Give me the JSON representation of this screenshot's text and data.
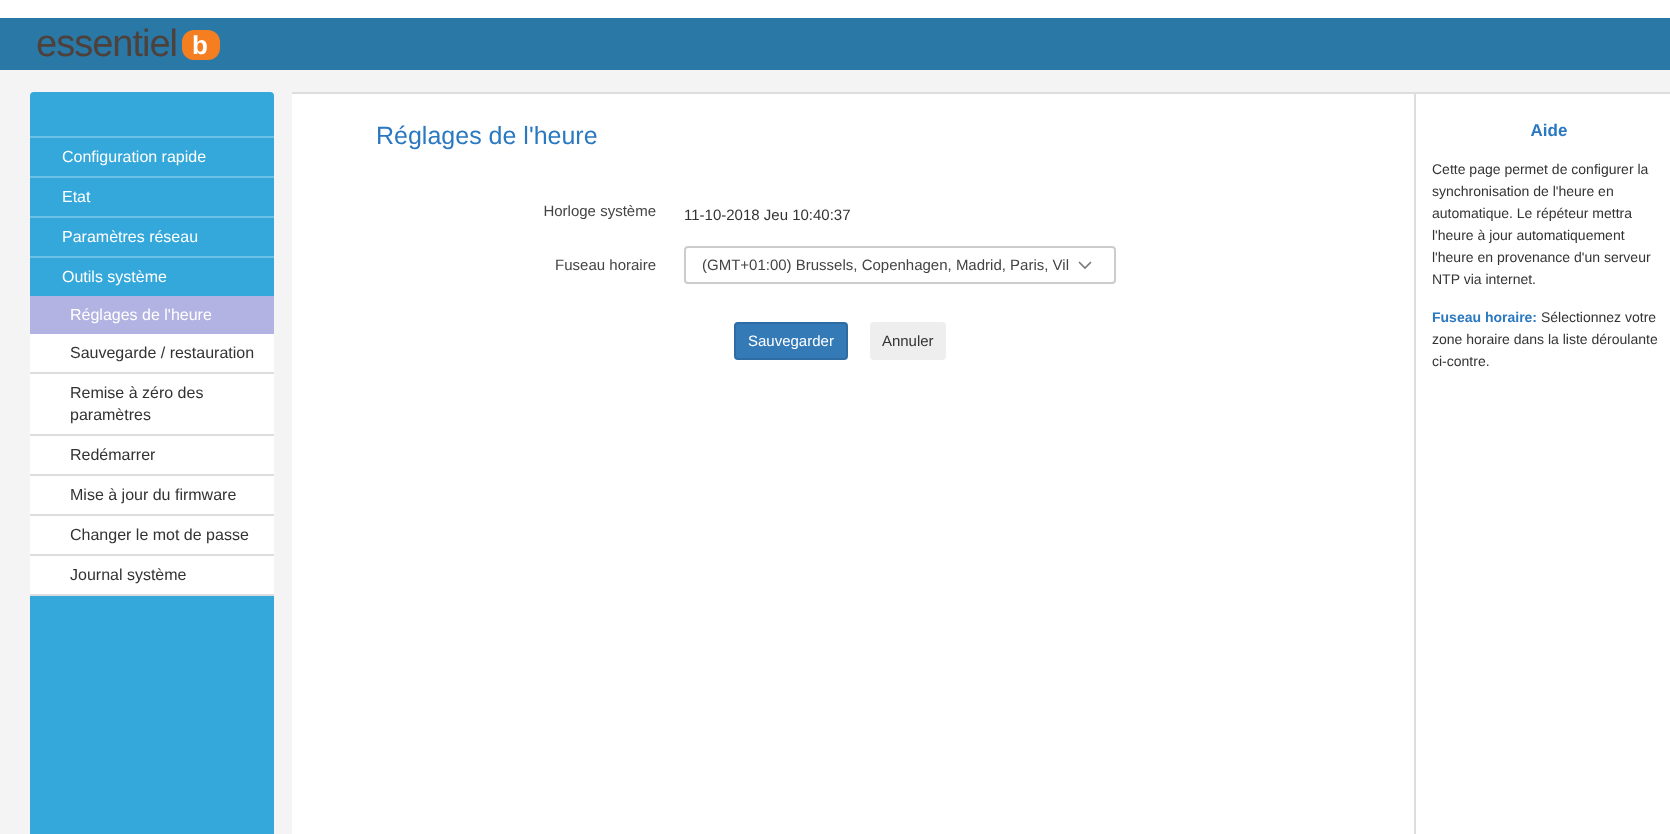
{
  "header": {
    "logo_text": "essentiel",
    "logo_mark": "b"
  },
  "sidebar": {
    "items": [
      {
        "label": "Configuration rapide",
        "selected": false
      },
      {
        "label": "Etat",
        "selected": false
      },
      {
        "label": "Paramètres réseau",
        "selected": false
      },
      {
        "label": "Outils système",
        "selected": false,
        "expanded": true,
        "children": [
          {
            "label": "Réglages de l'heure",
            "selected": true
          },
          {
            "label": "Sauvegarde / restauration",
            "selected": false
          },
          {
            "label": "Remise à zéro des paramètres",
            "selected": false
          },
          {
            "label": "Redémarrer",
            "selected": false
          },
          {
            "label": "Mise à jour du firmware",
            "selected": false
          },
          {
            "label": "Changer le mot de passe",
            "selected": false
          },
          {
            "label": "Journal système",
            "selected": false
          }
        ]
      }
    ]
  },
  "main": {
    "title": "Réglages de l'heure",
    "fields": [
      {
        "kind": "text",
        "label": "Horloge système",
        "value": "11-10-2018 Jeu 10:40:37"
      },
      {
        "kind": "select",
        "label": "Fuseau horaire",
        "value": "(GMT+01:00) Brussels, Copenhagen, Madrid, Paris, Vil"
      }
    ],
    "buttons": [
      {
        "label": "Sauvegarder",
        "kind": "primary"
      },
      {
        "label": "Annuler",
        "kind": "secondary"
      }
    ]
  },
  "help": {
    "title": "Aide",
    "paragraphs": [
      "Cette page permet de configurer la synchronisation de l'heure en automatique. Le répéteur mettra l'heure à jour automatiquement l'heure en provenance d'un serveur NTP via internet.",
      "**Fuseau horaire:** Sélectionnez votre zone horaire dans la liste déroulante ci-contre."
    ]
  }
}
